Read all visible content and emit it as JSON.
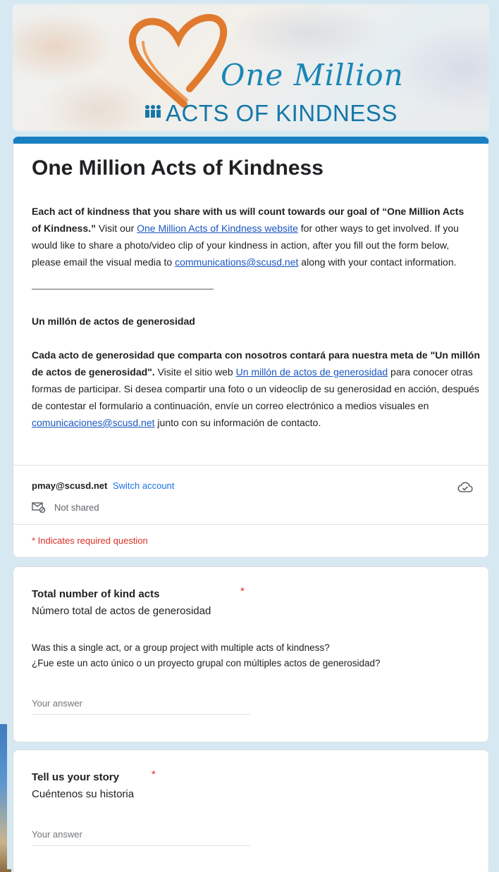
{
  "banner": {
    "logo_script": "One Million",
    "logo_caps": "ACTS OF KINDNESS",
    "heart_color": "#e07a2e",
    "brand_blue": "#1477a8"
  },
  "form": {
    "title": "One Million Acts of Kindness",
    "desc_en_bold": "Each act of kindness that you share with us will count towards our goal of “One Million Acts of Kindness.”",
    "desc_en_1": " Visit our ",
    "desc_en_link": "One Million Acts of Kindness website",
    "desc_en_2": " for other ways to get involved. If you would like to share a photo/video clip of your kindness in action, after you fill out the form below, please email the visual media to ",
    "desc_en_email": "communications@scusd.net",
    "desc_en_3": " along with your contact information.",
    "es_heading": "Un millón de actos de generosidad",
    "desc_es_bold": "Cada acto de generosidad que comparta con nosotros contará para nuestra meta de \"Un millón de actos de generosidad\".",
    "desc_es_1": " Visite el sitio web ",
    "desc_es_link": "Un millón de actos de generosidad",
    "desc_es_2": " para conocer otras formas de participar. Si desea compartir una foto o un videoclip de su generosidad en acción, después de contestar el formulario a continuación, envíe un correo electrónico a medios visuales en ",
    "desc_es_email": "comunicaciones@scusd.net",
    "desc_es_3": " junto con su información de contacto.",
    "accent_color": "#1a7fc1"
  },
  "account": {
    "email": "pmay@scusd.net",
    "switch_label": "Switch account",
    "not_shared": "Not shared",
    "required_note": "* Indicates required question"
  },
  "questions": [
    {
      "title": "Total number of kind acts",
      "star": "*",
      "subtitle": "Número total de actos de generosidad",
      "help_en": "Was this a single act, or a group project with multiple acts of kindness?",
      "help_es": "¿Fue este un acto único o un proyecto grupal con múltiples actos de generosidad?",
      "placeholder": "Your answer"
    },
    {
      "title": "Tell us your story",
      "star": "*",
      "subtitle": "Cuéntenos su historia",
      "placeholder": "Your answer"
    }
  ]
}
